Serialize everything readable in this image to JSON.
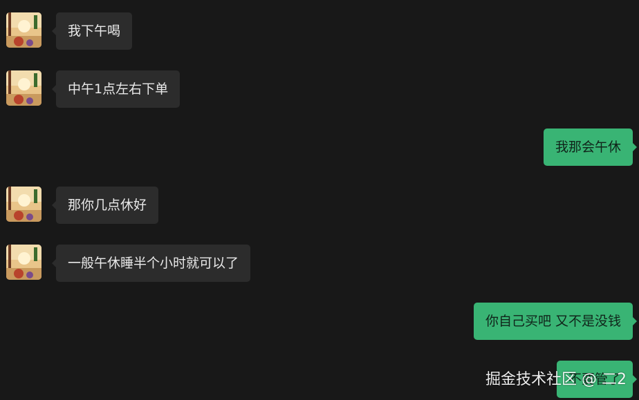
{
  "messages": [
    {
      "side": "left",
      "text": "我下午喝"
    },
    {
      "side": "left",
      "text": "中午1点左右下单"
    },
    {
      "side": "right",
      "text": "我那会午休"
    },
    {
      "side": "left",
      "text": "那你几点休好"
    },
    {
      "side": "left",
      "text": "一般午休睡半个小时就可以了"
    },
    {
      "side": "right",
      "text": "你自己买吧 又不是没钱"
    },
    {
      "side": "right",
      "text": "不要管了"
    }
  ],
  "watermark": "掘金技术社区 @ 二2",
  "colors": {
    "background": "#181818",
    "incoming_bubble": "#2c2c2c",
    "outgoing_bubble": "#39b474"
  }
}
